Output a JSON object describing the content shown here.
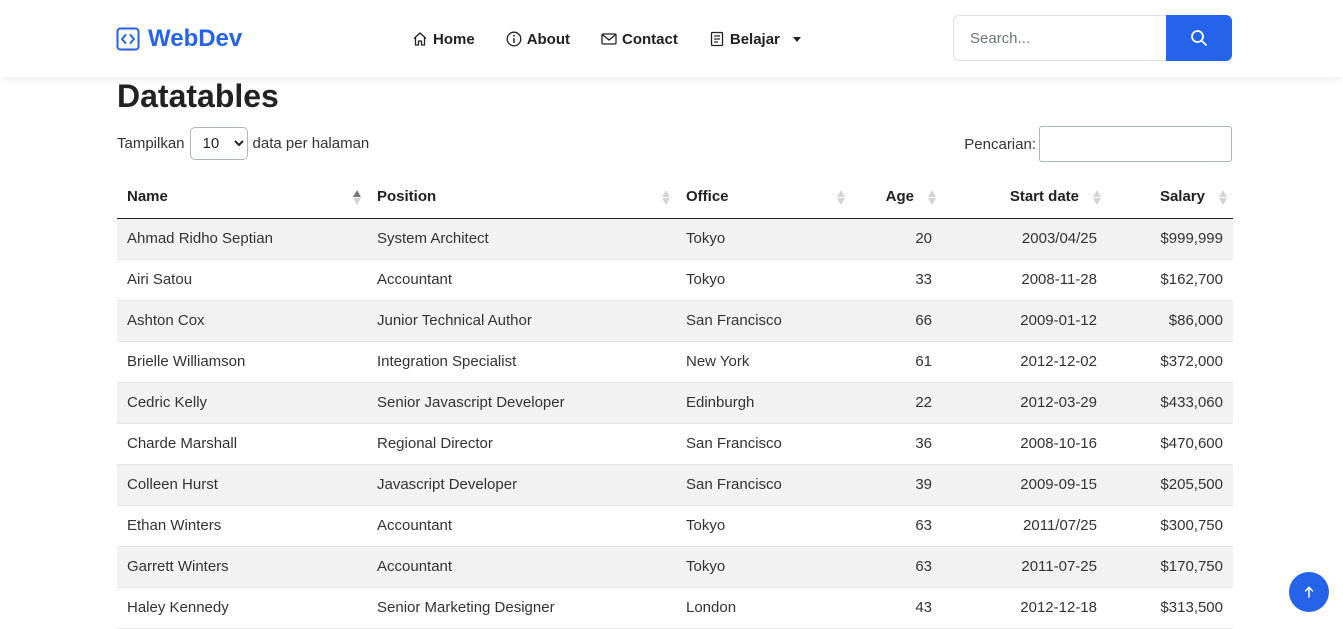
{
  "navbar": {
    "brand": "WebDev",
    "links": [
      {
        "label": "Home",
        "icon": "home-icon"
      },
      {
        "label": "About",
        "icon": "info-icon"
      },
      {
        "label": "Contact",
        "icon": "envelope-icon"
      },
      {
        "label": "Belajar",
        "icon": "journal-icon",
        "dropdown": true
      }
    ],
    "search": {
      "placeholder": "Search...",
      "button_icon": "search-icon"
    }
  },
  "page": {
    "title": "Datatables"
  },
  "length_control": {
    "prefix": "Tampilkan",
    "selected": "10",
    "suffix": "data per halaman"
  },
  "filter_control": {
    "label": "Pencarian:",
    "value": ""
  },
  "table": {
    "columns": [
      "Name",
      "Position",
      "Office",
      "Age",
      "Start date",
      "Salary"
    ],
    "sorted_column": "Name",
    "sort_direction": "ascending",
    "rows": [
      [
        "Ahmad Ridho Septian",
        "System Architect",
        "Tokyo",
        "20",
        "2003/04/25",
        "$999,999"
      ],
      [
        "Airi Satou",
        "Accountant",
        "Tokyo",
        "33",
        "2008-11-28",
        "$162,700"
      ],
      [
        "Ashton Cox",
        "Junior Technical Author",
        "San Francisco",
        "66",
        "2009-01-12",
        "$86,000"
      ],
      [
        "Brielle Williamson",
        "Integration Specialist",
        "New York",
        "61",
        "2012-12-02",
        "$372,000"
      ],
      [
        "Cedric Kelly",
        "Senior Javascript Developer",
        "Edinburgh",
        "22",
        "2012-03-29",
        "$433,060"
      ],
      [
        "Charde Marshall",
        "Regional Director",
        "San Francisco",
        "36",
        "2008-10-16",
        "$470,600"
      ],
      [
        "Colleen Hurst",
        "Javascript Developer",
        "San Francisco",
        "39",
        "2009-09-15",
        "$205,500"
      ],
      [
        "Ethan Winters",
        "Accountant",
        "Tokyo",
        "63",
        "2011/07/25",
        "$300,750"
      ],
      [
        "Garrett Winters",
        "Accountant",
        "Tokyo",
        "63",
        "2011-07-25",
        "$170,750"
      ],
      [
        "Haley Kennedy",
        "Senior Marketing Designer",
        "London",
        "43",
        "2012-12-18",
        "$313,500"
      ]
    ]
  },
  "colors": {
    "accent": "#2563eb",
    "stripe": "#f2f2f2",
    "text": "#212529"
  },
  "scroll_top_button": {
    "icon": "arrow-up-icon"
  }
}
